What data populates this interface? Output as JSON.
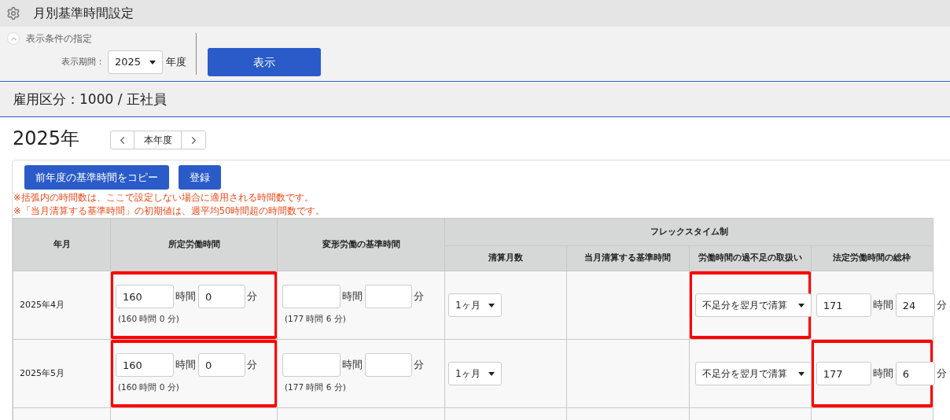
{
  "page": {
    "title": "月別基準時間設定"
  },
  "filter": {
    "toggle_label": "表示条件の指定",
    "expanded": true,
    "period_label": "表示期間：",
    "year": "2025",
    "year_suffix": "年度",
    "show_button": "表示"
  },
  "employment": "雇用区分：1000 / 正社員",
  "year_title": "2025年",
  "nav": {
    "current": "本年度"
  },
  "actions": [
    "前年度の基準時間をコピー",
    "登録"
  ],
  "notes": [
    "※括弧内の時間数は、ここで設定しない場合に適用される時間数です。",
    "※「当月清算する基準時間」の初期値は、週平均50時間超の時間数です。"
  ],
  "table": {
    "columns": {
      "month": "年月",
      "scheduled": "所定労働時間",
      "variable": "変形労働の基準時間",
      "flex_group": "フレックスタイム制",
      "settlement_months": "清算月数",
      "current_settlement": "当月清算する基準時間",
      "shortage": "労働時間の過不足の取扱い",
      "statutory": "法定労働時間の総枠"
    },
    "rows": [
      {
        "month": "2025年4月",
        "scheduled": {
          "highlighted": true,
          "hours": {
            "value": "160",
            "unit": "時間"
          },
          "minutes": {
            "value": "0",
            "unit": "分"
          },
          "default": "(160 時間 0 分)"
        },
        "variable": {
          "highlighted": false,
          "hours": {
            "unit": "時間"
          },
          "minutes": {
            "unit": "分"
          },
          "default": "(177 時間 6 分)"
        },
        "settlement_months": "1ヶ月",
        "shortage": {
          "highlighted": true,
          "value": "不足分を翌月で清算"
        },
        "statutory": {
          "highlighted": false,
          "hours": {
            "value": "171",
            "unit": "時間"
          },
          "minutes": {
            "value": "24",
            "unit": "分"
          }
        }
      },
      {
        "month": "2025年5月",
        "scheduled": {
          "highlighted": true,
          "hours": {
            "value": "160",
            "unit": "時間"
          },
          "minutes": {
            "value": "0",
            "unit": "分"
          },
          "default": "(160 時間 0 分)"
        },
        "variable": {
          "highlighted": false,
          "hours": {
            "unit": "時間"
          },
          "minutes": {
            "unit": "分"
          },
          "default": "(177 時間 6 分)"
        },
        "settlement_months": "1ヶ月",
        "shortage": {
          "highlighted": false,
          "value": "不足分を翌月で清算"
        },
        "statutory": {
          "highlighted": true,
          "hours": {
            "value": "177",
            "unit": "時間"
          },
          "minutes": {
            "value": "6",
            "unit": "分"
          }
        }
      }
    ]
  }
}
